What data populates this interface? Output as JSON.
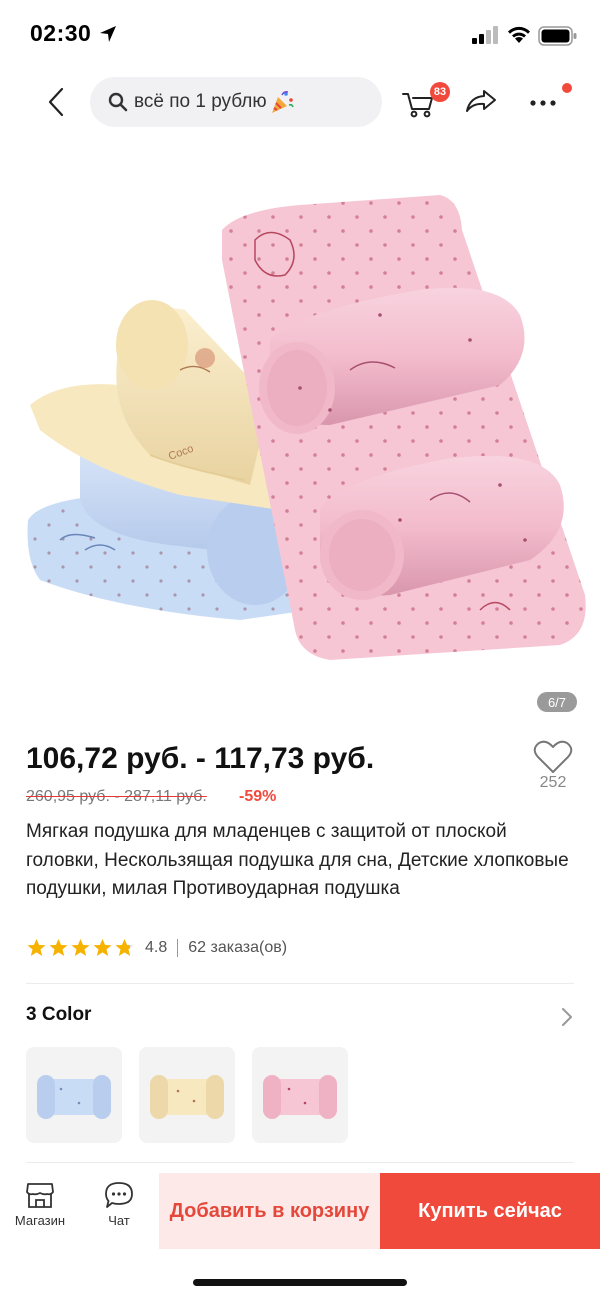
{
  "status_bar": {
    "time": "02:30"
  },
  "nav": {
    "search_text": "всё по 1 рублю",
    "cart_count": "83"
  },
  "gallery": {
    "counter": "6/7"
  },
  "product": {
    "price": "106,72 руб. - 117,73 руб.",
    "old_price": "260,95 руб. - 287,11 руб.",
    "discount": "-59%",
    "favorites": "252",
    "title": "Мягкая подушка для младенцев с защитой от плоской головки, Нескользящая подушка для сна, Детские хлопковые подушки, милая Противоударная подушка",
    "rating": "4.8",
    "rating_stars": 4.8,
    "orders": "62 заказа(ов)"
  },
  "colors": {
    "title": "3 Color",
    "options": [
      "blue",
      "yellow",
      "pink"
    ]
  },
  "bottom_bar": {
    "store_label": "Магазин",
    "chat_label": "Чат",
    "add_to_cart": "Добавить в корзину",
    "buy_now": "Купить сейчас"
  },
  "theme": {
    "accent": "#ef4a3c",
    "star": "#f5b300",
    "pink": "#f6c6d4",
    "yellow": "#f7e8bf",
    "blue": "#c9dcf5"
  },
  "icons": [
    "location-arrow-icon",
    "signal-icon",
    "wifi-icon",
    "battery-icon",
    "back-icon",
    "search-icon",
    "party-icon",
    "cart-icon",
    "share-icon",
    "more-icon",
    "heart-icon",
    "star-icon",
    "chevron-right-icon",
    "store-icon",
    "chat-icon"
  ]
}
